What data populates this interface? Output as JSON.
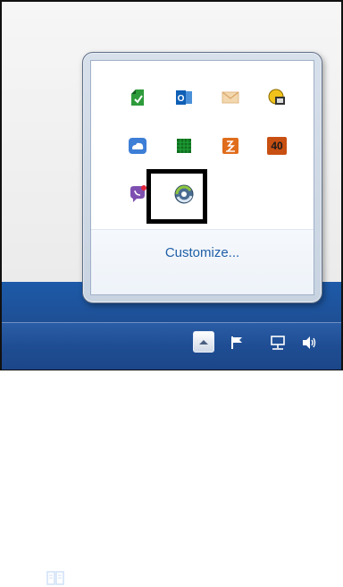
{
  "tray_flyout": {
    "icons_row1": [
      "evernote-icon",
      "outlook-icon",
      "mail-icon",
      "network-sync-icon"
    ],
    "icons_row2": [
      "onedrive-icon",
      "green-grid-icon",
      "sound-recorder-icon",
      "badge-40-icon"
    ],
    "icons_row3": [
      "viber-icon",
      "highlighted-app-icon"
    ],
    "badge_text": "40",
    "customize_label": "Customize..."
  },
  "taskbar": {
    "tray_icons": [
      "show-hidden-icons-chevron",
      "action-center-flag-icon",
      "network-icon",
      "volume-icon"
    ]
  },
  "colors": {
    "taskbar": "#1f4d93",
    "flyout_frame": "#c8d3e1",
    "link": "#1f5fa8",
    "highlight_border": "#000000"
  }
}
